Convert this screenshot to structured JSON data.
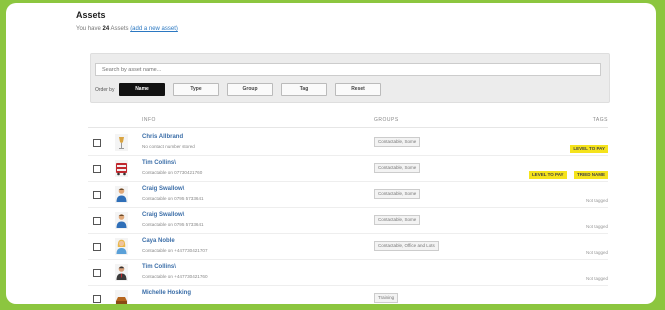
{
  "page": {
    "title": "Assets",
    "subtitle_prefix": "You have ",
    "asset_count": "24",
    "subtitle_suffix": " Assets ",
    "add_link": "(add a new asset)"
  },
  "search": {
    "placeholder": "Search by asset name..."
  },
  "filters": {
    "label": "Order by",
    "buttons": [
      "Name",
      "Type",
      "Group",
      "Tag",
      "Reset"
    ],
    "active": "Name"
  },
  "table": {
    "columns": [
      "INFO",
      "GROUPS",
      "TAGS"
    ],
    "rows": [
      {
        "name": "Chris Allbrand",
        "meta": "No contact number stored",
        "group": "Contactable, Some",
        "tags": [
          "LEVEL TO PAY"
        ],
        "avatar": "wine-glass-icon"
      },
      {
        "name": "Tim Collins\\",
        "meta": "Contactable on 07730421760",
        "group": "Contactable, Some",
        "tags": [
          "LEVEL TO PAY",
          "TRIED NAME"
        ],
        "avatar": "bus-icon"
      },
      {
        "name": "Craig Swallow\\",
        "meta": "Contactable on 0795 5733641",
        "group": "Contactable, Some",
        "tags": [],
        "no_tag": "Not tagged",
        "avatar": "person-icon"
      },
      {
        "name": "Craig Swallow\\",
        "meta": "Contactable on 0795 5733641",
        "group": "Contactable, Some",
        "tags": [],
        "no_tag": "Not tagged",
        "avatar": "person-icon"
      },
      {
        "name": "Caya Noble",
        "meta": "Contactable on +447730421707",
        "group": "Contactable, Office and Lots",
        "tags": [],
        "no_tag": "Not tagged",
        "avatar": "woman-icon"
      },
      {
        "name": "Tim Collins\\",
        "meta": "Contactable on +447730421760",
        "group": "",
        "tags": [],
        "no_tag": "Not tagged",
        "avatar": "man-icon"
      },
      {
        "name": "Michelle Hosking",
        "meta": "",
        "group": "Training",
        "tags": [],
        "no_tag": "",
        "avatar": "car-icon"
      }
    ]
  },
  "colors": {
    "frame": "#8cc63f",
    "link": "#3b6ea8",
    "tag": "#f5e31c"
  }
}
